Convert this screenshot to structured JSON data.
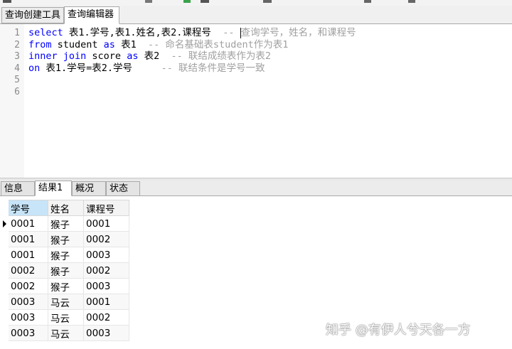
{
  "editor_tabs": [
    {
      "label": "查询创建工具",
      "active": false
    },
    {
      "label": "查询编辑器",
      "active": true
    }
  ],
  "editor": {
    "lines": [
      {
        "num": "1",
        "tokens": [
          {
            "t": "select",
            "k": "kw"
          },
          {
            "t": " 表1.学号,表1.姓名,表2.课程号  ",
            "k": "tx"
          },
          {
            "t": "-- ",
            "k": "cm"
          },
          {
            "t": "",
            "k": "caret"
          },
          {
            "t": "查询学号，姓名，和课程号",
            "k": "cm"
          }
        ]
      },
      {
        "num": "2",
        "tokens": [
          {
            "t": "from",
            "k": "kw"
          },
          {
            "t": " student ",
            "k": "tx"
          },
          {
            "t": "as",
            "k": "kw"
          },
          {
            "t": " 表1  ",
            "k": "tx"
          },
          {
            "t": "-- 命名基础表student作为表1",
            "k": "cm"
          }
        ]
      },
      {
        "num": "3",
        "tokens": [
          {
            "t": "inner",
            "k": "kw"
          },
          {
            "t": " ",
            "k": "tx"
          },
          {
            "t": "join",
            "k": "kw"
          },
          {
            "t": " score ",
            "k": "tx"
          },
          {
            "t": "as",
            "k": "kw"
          },
          {
            "t": " 表2  ",
            "k": "tx"
          },
          {
            "t": "-- 联结成绩表作为表2",
            "k": "cm"
          }
        ]
      },
      {
        "num": "4",
        "tokens": [
          {
            "t": "on",
            "k": "kw"
          },
          {
            "t": " 表1.学号=表2.学号     ",
            "k": "tx"
          },
          {
            "t": "-- 联结条件是学号一致",
            "k": "cm"
          }
        ]
      },
      {
        "num": "5",
        "tokens": []
      },
      {
        "num": "6",
        "tokens": []
      }
    ]
  },
  "result_tabs": [
    {
      "label": "信息",
      "active": false
    },
    {
      "label": "结果1",
      "active": true
    },
    {
      "label": "概况",
      "active": false
    },
    {
      "label": "状态",
      "active": false
    }
  ],
  "grid": {
    "columns": [
      "学号",
      "姓名",
      "课程号"
    ],
    "rows": [
      [
        "0001",
        "猴子",
        "0001"
      ],
      [
        "0001",
        "猴子",
        "0002"
      ],
      [
        "0001",
        "猴子",
        "0003"
      ],
      [
        "0002",
        "猴子",
        "0002"
      ],
      [
        "0002",
        "猴子",
        "0003"
      ],
      [
        "0003",
        "马云",
        "0001"
      ],
      [
        "0003",
        "马云",
        "0002"
      ],
      [
        "0003",
        "马云",
        "0003"
      ]
    ]
  },
  "watermark": "知乎 @有伊人兮天各一方",
  "colors": {
    "keyword": "#0000ff",
    "comment": "#a0a0a0",
    "sorted_header": "#c7e4f8"
  }
}
